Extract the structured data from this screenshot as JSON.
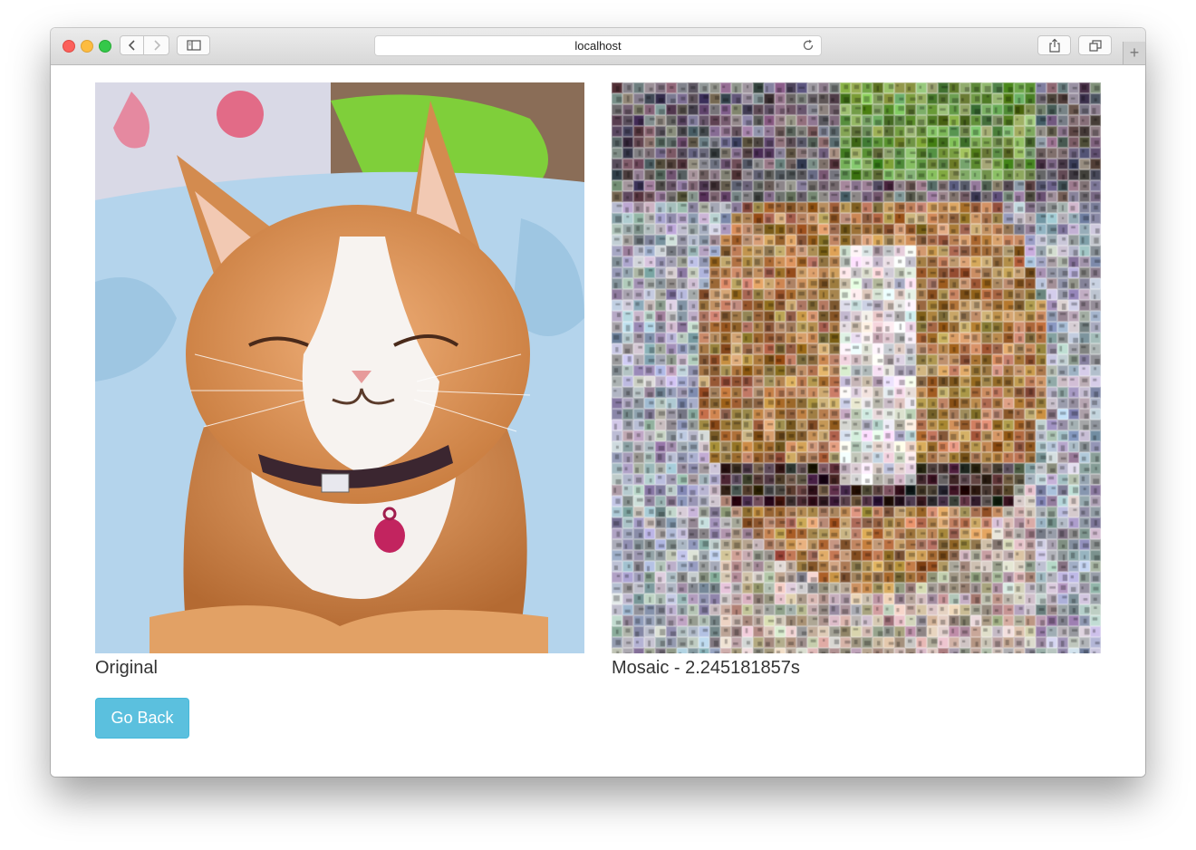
{
  "browser": {
    "url": "localhost",
    "icons": {
      "back": "chevron-left-icon",
      "forward": "chevron-right-icon",
      "sidebar": "sidebar-icon",
      "reload": "reload-icon",
      "share": "share-icon",
      "tabs": "tabs-overview-icon",
      "new_tab": "plus-icon"
    }
  },
  "main": {
    "original": {
      "caption": "Original",
      "image": "smiling orange and white cat"
    },
    "mosaic": {
      "caption": "Mosaic - 2.245181857s",
      "image": "photo mosaic of the cat"
    },
    "go_back_label": "Go Back"
  },
  "colors": {
    "button_bg": "#5bc0de",
    "traffic_red": "#fc605b",
    "traffic_yellow": "#fdbc40",
    "traffic_green": "#34c84a"
  }
}
